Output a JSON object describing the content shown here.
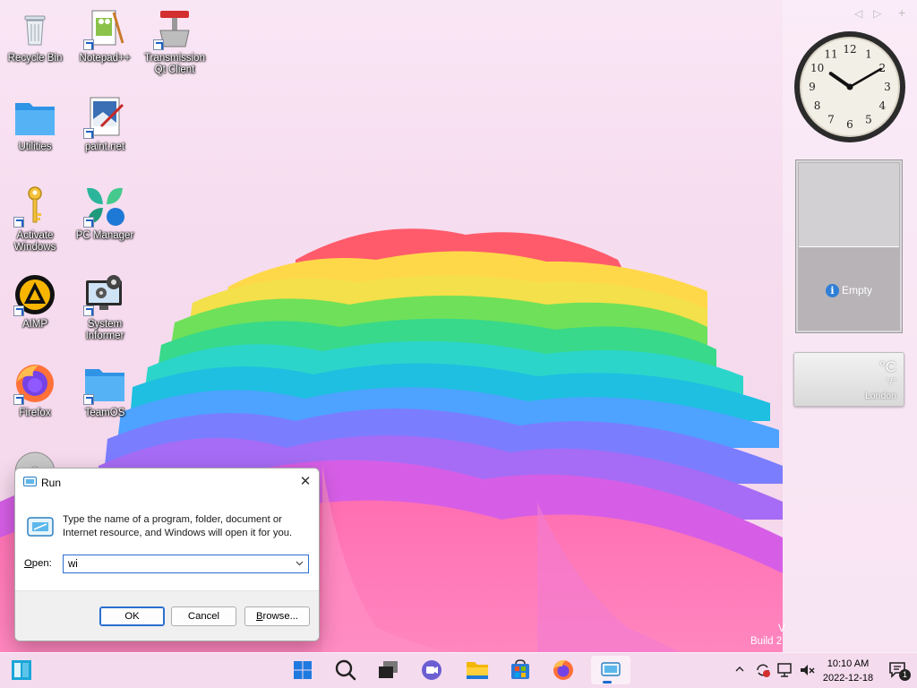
{
  "desktop": {
    "icons": [
      {
        "id": "recycle",
        "label": "Recycle Bin"
      },
      {
        "id": "notepadpp",
        "label": "Notepad++"
      },
      {
        "id": "transmission",
        "label": "Transmission\nQt Client"
      },
      {
        "id": "utilities",
        "label": "Utilities"
      },
      {
        "id": "paintnet",
        "label": "paint.net"
      },
      {
        "id": "activate",
        "label": "Activate\nWindows"
      },
      {
        "id": "pcmanager",
        "label": "PC Manager"
      },
      {
        "id": "aimp",
        "label": "AIMP"
      },
      {
        "id": "sysinformer",
        "label": "System\nInformer"
      },
      {
        "id": "firefox",
        "label": "Firefox"
      },
      {
        "id": "teamos",
        "label": "TeamOS"
      }
    ]
  },
  "sidebar": {
    "controls": {
      "prev": "◁",
      "next": "▷",
      "add": "+"
    },
    "clock": {
      "time": "10:10",
      "numerals": [
        "12",
        "1",
        "2",
        "3",
        "4",
        "5",
        "6",
        "7",
        "8",
        "9",
        "10",
        "11"
      ]
    },
    "slideshow": {
      "info_icon": "i",
      "message": "Empty"
    },
    "weather": {
      "temp_unit": "°C",
      "condition": "°/°",
      "city": "London"
    }
  },
  "watermark": {
    "line1": "V",
    "line2": "Build 2"
  },
  "run_dialog": {
    "title": "Run",
    "close_glyph": "✕",
    "description": "Type the name of a program, folder, document or Internet resource, and Windows will open it for you.",
    "open_label_prefix": "",
    "open_label_underlined": "O",
    "open_label_rest": "pen:",
    "input_value": "wi",
    "ok_label": "OK",
    "cancel_label": "Cancel",
    "browse_label_underlined": "B",
    "browse_label_rest": "rowse..."
  },
  "taskbar": {
    "items": [
      "widgets",
      "start",
      "search",
      "task-view",
      "teams",
      "file-explorer",
      "store",
      "firefox",
      "run"
    ],
    "time": "10:10 AM",
    "date": "2022-12-18",
    "notification_count": "1"
  },
  "colors": {
    "accent": "#1e6bd0",
    "dialog_focus": "#2b6fcf"
  }
}
